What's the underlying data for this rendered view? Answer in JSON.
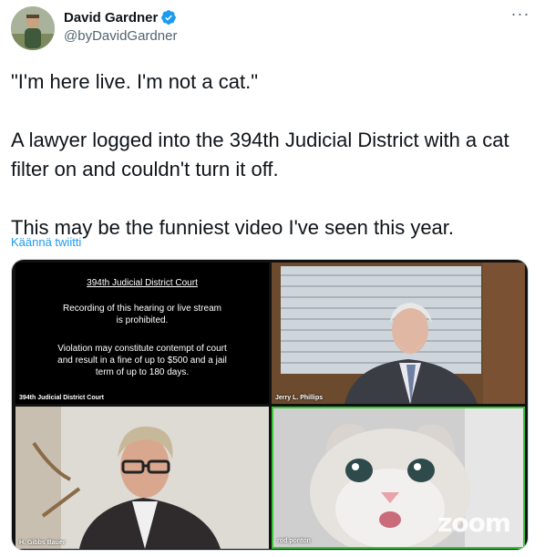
{
  "author": {
    "name": "David Gardner",
    "handle": "@byDavidGardner",
    "verified": true
  },
  "menu_icon": "more-dots-icon",
  "tweet": {
    "line1": "\"I'm here live. I'm not a cat.\"",
    "line2": "A lawyer logged into the 394th Judicial District with a cat filter on and couldn't turn it off.",
    "line3": "This may be the funniest video I've seen this year."
  },
  "translate_link": "Käännä twiitti",
  "media": {
    "tiles": [
      {
        "title": "394th Judicial District Court",
        "recording": "Recording of this hearing or live stream is prohibited.",
        "violation": "Violation may constitute contempt of court and result in a fine of up to $500 and a jail term of up to 180 days.",
        "label": "394th Judicial District Court"
      },
      {
        "label": "Jerry L. Phillips"
      },
      {
        "label": "H. Gibbs Bauer"
      },
      {
        "label": "rod ponton",
        "watermark": "zoom"
      }
    ]
  },
  "colors": {
    "link": "#1d9bf0",
    "verified": "#1d9bf0",
    "active_speaker": "#37c837"
  }
}
